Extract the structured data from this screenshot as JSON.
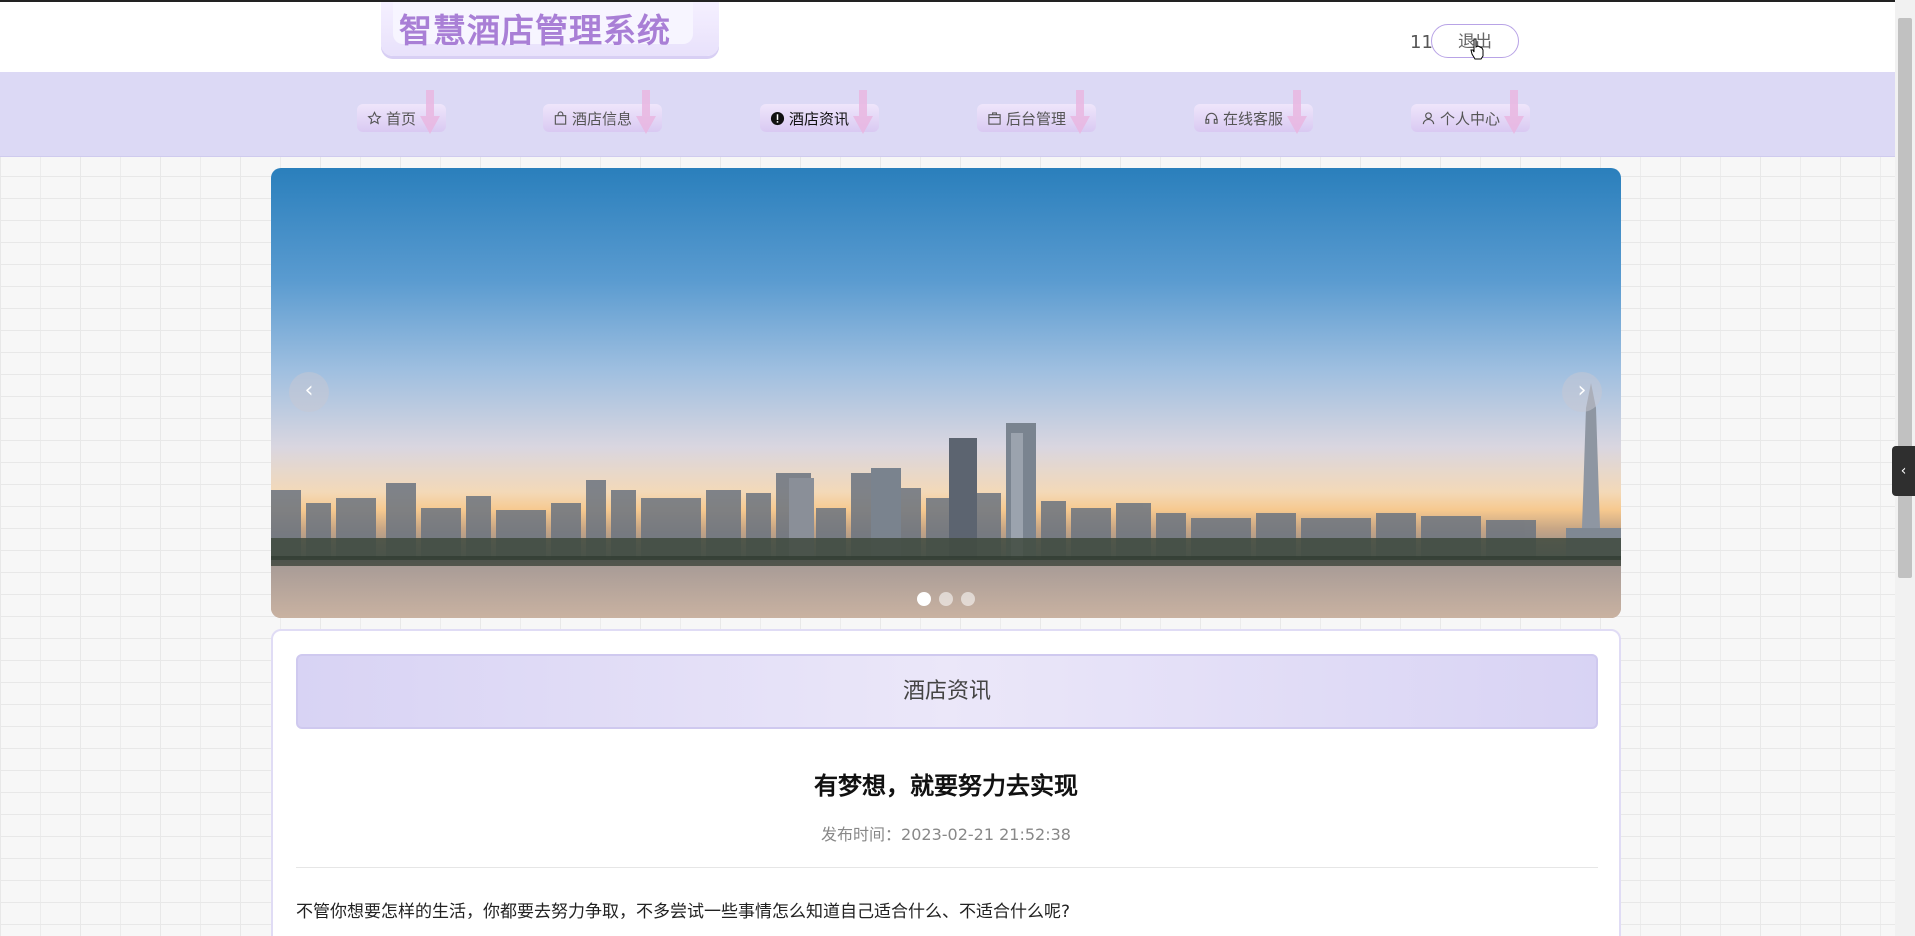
{
  "header": {
    "logo_text": "智慧酒店管理系统",
    "username": "11",
    "logout_label": "退出"
  },
  "nav": {
    "items": [
      {
        "label": "首页",
        "icon": "star-icon"
      },
      {
        "label": "酒店信息",
        "icon": "bag-icon"
      },
      {
        "label": "酒店资讯",
        "icon": "info-icon",
        "active": true
      },
      {
        "label": "后台管理",
        "icon": "box-icon"
      },
      {
        "label": "在线客服",
        "icon": "headset-icon"
      },
      {
        "label": "个人中心",
        "icon": "user-icon"
      }
    ]
  },
  "carousel": {
    "prev": "‹",
    "next": "›",
    "slides": 3,
    "active_slide": 1
  },
  "section": {
    "title": "酒店资讯"
  },
  "article": {
    "title": "有梦想，就要努力去实现",
    "meta": "发布时间：2023-02-21 21:52:38",
    "body": "不管你想要怎样的生活，你都要去努力争取，不多尝试一些事情怎么知道自己适合什么、不适合什么呢?"
  },
  "side_tab": {
    "label": "‹"
  }
}
